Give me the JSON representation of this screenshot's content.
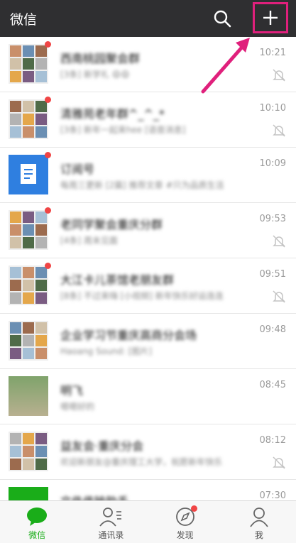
{
  "header": {
    "title": "微信",
    "search_icon": "search-icon",
    "add_icon": "plus-icon"
  },
  "chats": [
    {
      "name": "西南桃园聚会群",
      "preview": "[3条] 新学礼 😄😄",
      "time": "10:21",
      "muted": true,
      "unread_dot": true,
      "avatar": "group-grid"
    },
    {
      "name": "清雅苑老年群^_^_*",
      "preview": "[3条] 新年一起来hee [语音消息]",
      "time": "10:10",
      "muted": true,
      "unread_dot": true,
      "avatar": "group-grid"
    },
    {
      "name": "订阅号",
      "preview": "每周三更新 [2篇] 推荐文章 #只为品质生活",
      "time": "10:09",
      "muted": false,
      "unread_dot": true,
      "avatar": "subscription"
    },
    {
      "name": "老同学聚会重庆分群",
      "preview": "[4条] 周末见面",
      "time": "09:53",
      "muted": true,
      "unread_dot": true,
      "avatar": "group-grid"
    },
    {
      "name": "大江卡儿茶馆老朋友群",
      "preview": "[8条] 不过来嗨 [小视频] 新年快乐好运连连",
      "time": "09:51",
      "muted": true,
      "unread_dot": true,
      "avatar": "group-grid"
    },
    {
      "name": "企业学习节重庆高商分会场",
      "preview": "Haoang Sound: [图片]",
      "time": "09:48",
      "muted": false,
      "unread_dot": false,
      "avatar": "group-grid"
    },
    {
      "name": "明飞",
      "preview": "嗯嗯好的",
      "time": "08:45",
      "muted": false,
      "unread_dot": false,
      "avatar": "photo"
    },
    {
      "name": "益友会·重庆分会",
      "preview": "欢迎新朋友@重庆理工大学，祝愿新年快乐",
      "time": "08:12",
      "muted": true,
      "unread_dot": false,
      "avatar": "group-grid"
    },
    {
      "name": "文件传输助手",
      "preview": "",
      "time": "07:30",
      "muted": false,
      "unread_dot": false,
      "avatar": "file-transfer"
    }
  ],
  "tabs": [
    {
      "label": "微信",
      "icon": "chat-bubble-icon",
      "active": true,
      "dot": false
    },
    {
      "label": "通讯录",
      "icon": "contacts-icon",
      "active": false,
      "dot": false
    },
    {
      "label": "发现",
      "icon": "compass-icon",
      "active": false,
      "dot": true
    },
    {
      "label": "我",
      "icon": "person-icon",
      "active": false,
      "dot": false
    }
  ],
  "colors": {
    "header_bg": "#2f2f31",
    "accent_green": "#1aad19",
    "highlight_magenta": "#e0207c",
    "unread_red": "#f04545"
  }
}
